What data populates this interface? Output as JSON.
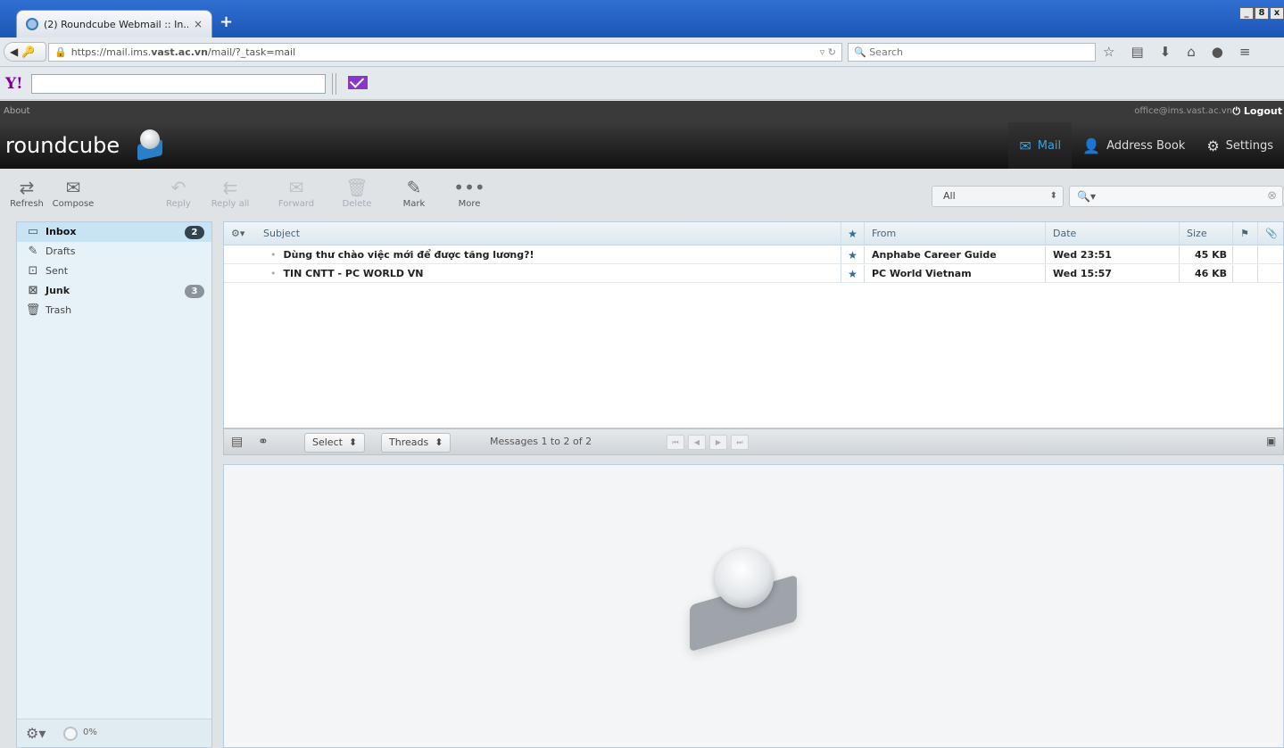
{
  "browser": {
    "tab_title": "(2) Roundcube Webmail :: In...",
    "tab_close": "×",
    "new_tab": "+",
    "url_prefix": "https://mail.ims.",
    "url_domain": "vast.ac.vn",
    "url_path": "/mail/?_task=mail",
    "search_placeholder": "Search",
    "window_controls": [
      "_",
      "8",
      "x"
    ]
  },
  "header": {
    "about": "About",
    "user": "office@ims.vast.ac.vn",
    "logout": "Logout",
    "logo_text": "roundcube",
    "nav": [
      {
        "label": "Mail",
        "icon": "mail-icon",
        "active": true
      },
      {
        "label": "Address Book",
        "icon": "person-icon",
        "active": false
      },
      {
        "label": "Settings",
        "icon": "gear-icon",
        "active": false
      }
    ]
  },
  "toolbar": {
    "refresh": "Refresh",
    "compose": "Compose",
    "reply": "Reply",
    "reply_all": "Reply all",
    "forward": "Forward",
    "delete": "Delete",
    "mark": "Mark",
    "more": "More",
    "filter_value": "All"
  },
  "folders": [
    {
      "name": "Inbox",
      "icon": "inbox-icon",
      "count": "2",
      "selected": true
    },
    {
      "name": "Drafts",
      "icon": "pencil-icon",
      "count": "",
      "selected": false
    },
    {
      "name": "Sent",
      "icon": "sent-icon",
      "count": "",
      "selected": false
    },
    {
      "name": "Junk",
      "icon": "junk-icon",
      "count": "3",
      "selected": false
    },
    {
      "name": "Trash",
      "icon": "trash-icon",
      "count": "",
      "selected": false
    }
  ],
  "quota": "0%",
  "list": {
    "columns": {
      "subject": "Subject",
      "from": "From",
      "date": "Date",
      "size": "Size"
    },
    "messages": [
      {
        "subject": "Dùng thư chào việc mới để được tăng lương?!",
        "from": "Anphabe Career Guide",
        "date": "Wed 23:51",
        "size": "45 KB"
      },
      {
        "subject": "TIN CNTT - PC WORLD VN",
        "from": "PC World Vietnam",
        "date": "Wed 15:57",
        "size": "46 KB"
      }
    ],
    "select_label": "Select",
    "threads_label": "Threads",
    "count_text": "Messages 1 to 2 of 2"
  }
}
